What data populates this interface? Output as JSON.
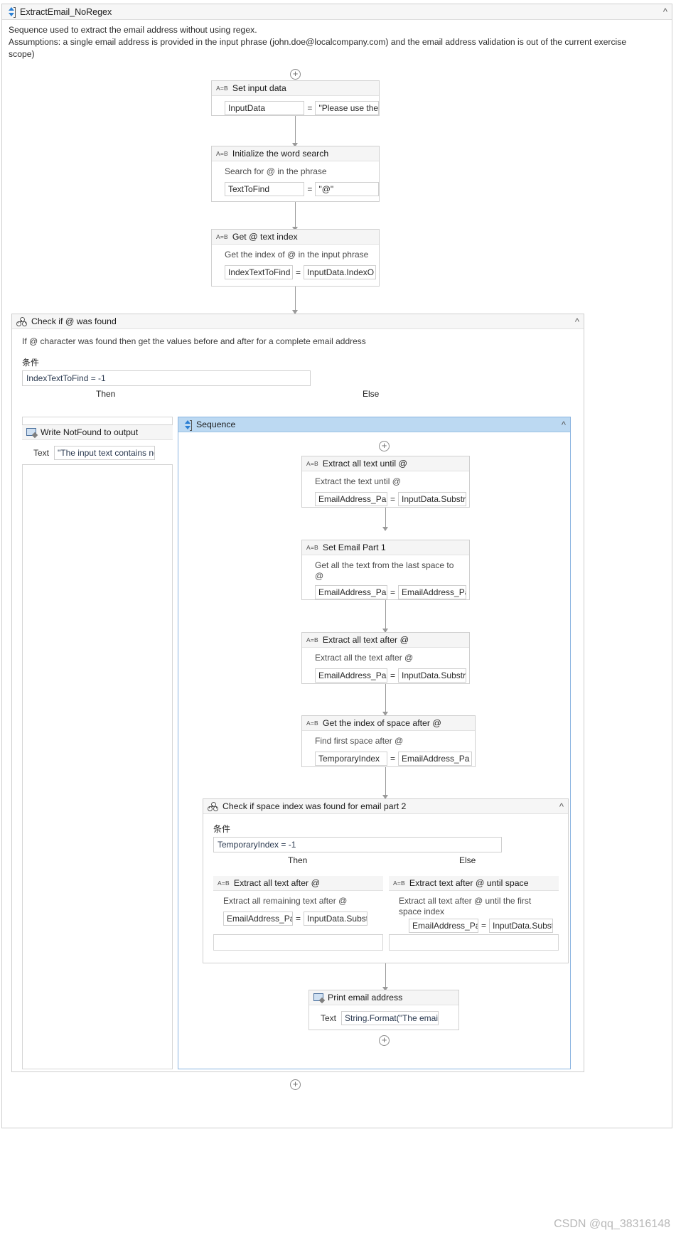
{
  "root": {
    "title": "ExtractEmail_NoRegex",
    "icon": "sequence-icon",
    "collapse_icon": "chevron-up-icon",
    "description": "Sequence used to extract the email address without using regex.\nAssumptions: a single email address is provided in the input phrase (john.doe@localcompany.com) and the email address validation is out of the current exercise scope)"
  },
  "activities": {
    "set_input_data": {
      "title": "Set input data",
      "icon": "assign-icon",
      "icon_label": "A=B",
      "to": "InputData",
      "equals": "=",
      "value": "\"Please use the fc"
    },
    "init_word_search": {
      "title": "Initialize the word search",
      "icon": "assign-icon",
      "icon_label": "A=B",
      "note": "Search for @ in the phrase",
      "to": "TextToFind",
      "equals": "=",
      "value": "\"@\""
    },
    "get_at_index": {
      "title": "Get @ text index",
      "icon": "assign-icon",
      "icon_label": "A=B",
      "note": "Get the index of @ in the input phrase",
      "to": "IndexTextToFind",
      "equals": "=",
      "value": "InputData.IndexO"
    },
    "extract_until_at": {
      "title": "Extract all text until @",
      "icon": "assign-icon",
      "icon_label": "A=B",
      "note": "Extract the text until @",
      "to": "EmailAddress_Pa",
      "equals": "=",
      "value": "InputData.Substri"
    },
    "set_email_part_1": {
      "title": "Set Email Part 1",
      "icon": "assign-icon",
      "icon_label": "A=B",
      "note": "Get all the text from the last space to @",
      "to": "EmailAddress_Pa",
      "equals": "=",
      "value": "EmailAddress_Pa"
    },
    "extract_after_at": {
      "title": "Extract all text after @",
      "icon": "assign-icon",
      "icon_label": "A=B",
      "note": "Extract all the text after @",
      "to": "EmailAddress_Pa",
      "equals": "=",
      "value": "InputData.Substri"
    },
    "get_space_index": {
      "title": "Get the index of space after @",
      "icon": "assign-icon",
      "icon_label": "A=B",
      "note": "Find first space after @",
      "to": "TemporaryIndex",
      "equals": "=",
      "value": "EmailAddress_Pa"
    },
    "extract_remaining_after_at": {
      "title": "Extract all text after @",
      "icon": "assign-icon",
      "icon_label": "A=B",
      "note": "Extract all remaining text after @",
      "to": "EmailAddress_Pa",
      "equals": "=",
      "value": "InputData.Substri"
    },
    "extract_after_at_until_space": {
      "title": "Extract text after @ until space",
      "icon": "assign-icon",
      "icon_label": "A=B",
      "note": "Extract all text after @ until the first space index",
      "to": "EmailAddress_Pa",
      "equals": "=",
      "value": "InputData.Substri"
    },
    "write_notfound": {
      "title": "Write NotFound to output",
      "icon": "write-line-icon",
      "text_label": "Text",
      "text_value": "\"The input text contains no"
    },
    "print_email": {
      "title": "Print email address",
      "icon": "write-line-icon",
      "text_label": "Text",
      "text_value": "String.Format(\"The email a"
    }
  },
  "if_outer": {
    "title": "Check if @ was found",
    "icon": "if-icon",
    "collapse_icon": "chevron-up-icon",
    "note": "If @ character was found then get the values before and after for a complete email address",
    "condition_label": "条件",
    "condition": "IndexTextToFind = -1",
    "then_label": "Then",
    "else_label": "Else"
  },
  "else_sequence": {
    "title": "Sequence",
    "icon": "sequence-icon",
    "collapse_icon": "chevron-up-icon"
  },
  "if_inner": {
    "title": "Check if space index was found for email part 2",
    "icon": "if-icon",
    "collapse_icon": "chevron-up-icon",
    "condition_label": "条件",
    "condition": "TemporaryIndex = -1",
    "then_label": "Then",
    "else_label": "Else"
  },
  "watermark": "CSDN @qq_38316148",
  "colors": {
    "accent": "#2a7fd4",
    "selection": "#bcd9f2",
    "border": "#d0d0d0",
    "header_bg": "#f5f5f5"
  }
}
